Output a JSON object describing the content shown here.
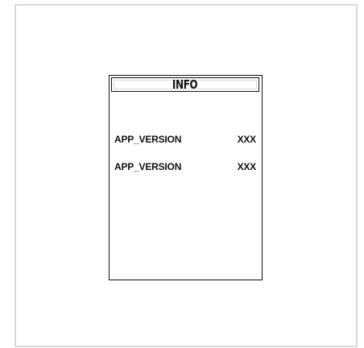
{
  "screen": {
    "title": "INFO",
    "rows": [
      {
        "label": "APP_VERSION",
        "value": "XXX"
      },
      {
        "label": "APP_VERSION",
        "value": "XXX"
      }
    ]
  }
}
